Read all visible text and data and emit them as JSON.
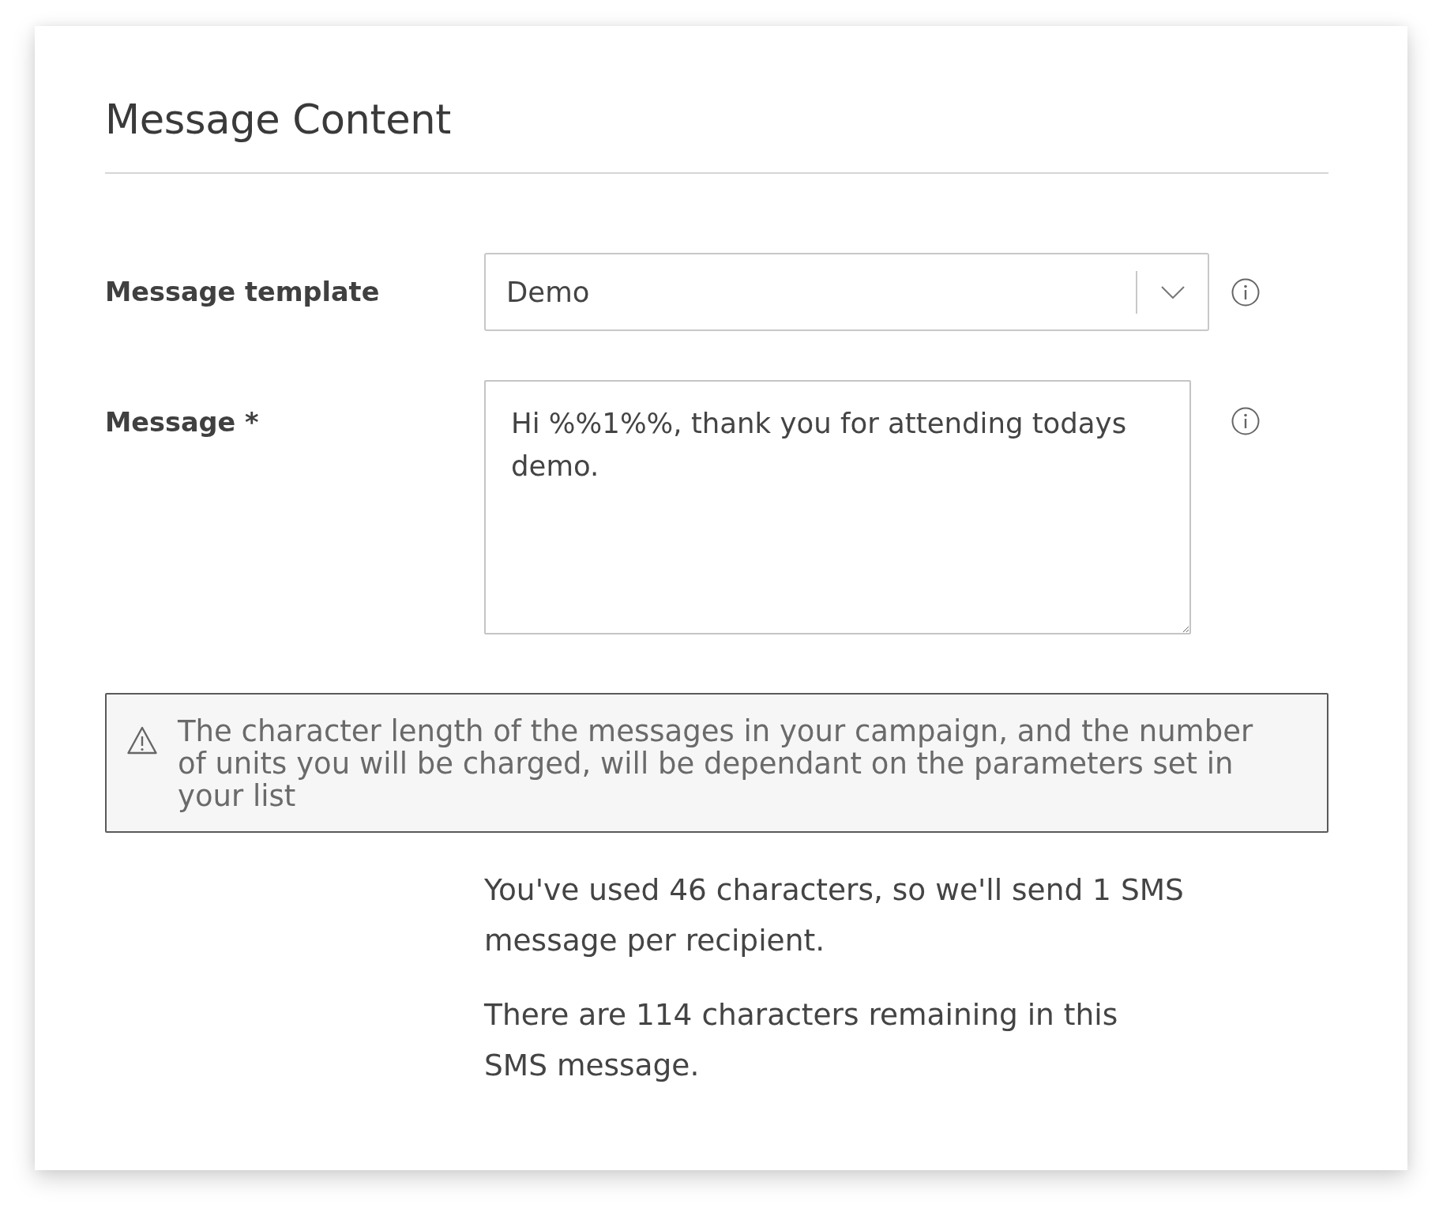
{
  "section": {
    "title": "Message Content"
  },
  "fields": [
    {
      "kind": "select",
      "label": "Message template",
      "value": "Demo"
    },
    {
      "kind": "textarea",
      "label": "Message *",
      "value": "Hi %%1%%, thank you for attending todays demo."
    }
  ],
  "notice": {
    "text": "The character length of the messages in your campaign, and the number of units you will be charged, will be dependant on the parameters set in your list"
  },
  "summary": [
    "You've used 46 characters, so we'll send 1 SMS message per recipient.",
    "There are 114 characters remaining in this SMS message."
  ]
}
